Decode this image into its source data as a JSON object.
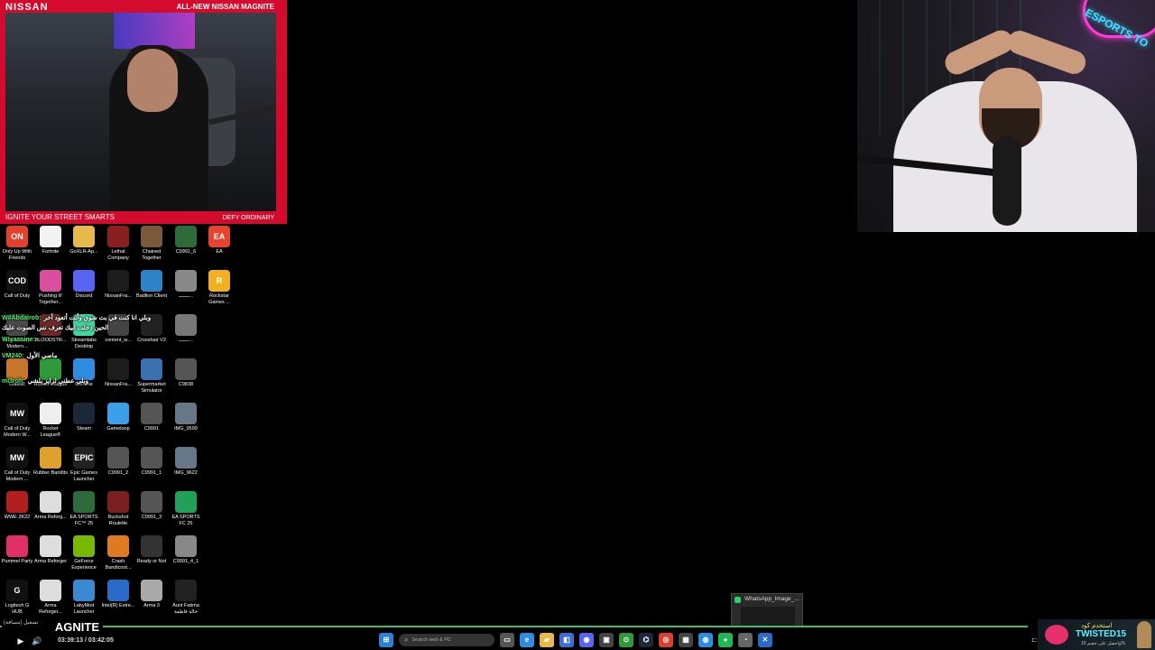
{
  "left_cam": {
    "brand": "NISSAN",
    "promo": "ALL-NEW NISSAN MAGNITE",
    "slogan": "IGNITE YOUR STREET SMARTS",
    "tagline": "DEFY ORDINARY"
  },
  "right_cam": {
    "neon_text": "ESPORTS TO"
  },
  "desktop_icons": [
    {
      "label": "Only Up With Friends",
      "glyph": "ON",
      "color": "#e2412b"
    },
    {
      "label": "Fortnite",
      "glyph": "",
      "color": "#f2f2f2"
    },
    {
      "label": "GoXLR-Ap...",
      "glyph": "",
      "color": "#e8b84a"
    },
    {
      "label": "Lethal Company",
      "glyph": "",
      "color": "#8a1f1f"
    },
    {
      "label": "Chained Together",
      "glyph": "",
      "color": "#7a5a3a"
    },
    {
      "label": "C9991_6",
      "glyph": "",
      "color": "#2f6b3a"
    },
    {
      "label": "EA",
      "glyph": "EA",
      "color": "#e8432d"
    },
    {
      "label": "Call of Duty",
      "glyph": "COD",
      "color": "#111111"
    },
    {
      "label": "Pushing it! Together...",
      "glyph": "",
      "color": "#d84fa0"
    },
    {
      "label": "Discord",
      "glyph": "",
      "color": "#5865f2"
    },
    {
      "label": "NissanFra...",
      "glyph": "",
      "color": "#1c1c1c"
    },
    {
      "label": "Badlion Client",
      "glyph": "",
      "color": "#2d82c8"
    },
    {
      "label": "ـــــــ...",
      "glyph": "",
      "color": "#888888"
    },
    {
      "label": "Rockstar Games ...",
      "glyph": "R",
      "color": "#f2b01e"
    },
    {
      "label": "Call of Duty Modern...",
      "glyph": "",
      "color": "#4a4a4a"
    },
    {
      "label": "BLOODSTR...",
      "glyph": "",
      "color": "#6b2a2a"
    },
    {
      "label": "Streamlabs Desktop",
      "glyph": "",
      "color": "#3fd6a0"
    },
    {
      "label": "content_w...",
      "glyph": "",
      "color": "#444444"
    },
    {
      "label": "Crosshair V2",
      "glyph": "",
      "color": "#222222"
    },
    {
      "label": "ـــــــ...",
      "glyph": "",
      "color": "#777777"
    },
    {
      "label": "Classic",
      "glyph": "",
      "color": "#c8742a"
    },
    {
      "label": "Rocket League",
      "glyph": "",
      "color": "#2f9a3a"
    },
    {
      "label": "Chrome",
      "glyph": "",
      "color": "#2f8de0"
    },
    {
      "label": "NissanFra...",
      "glyph": "",
      "color": "#1c1c1c"
    },
    {
      "label": "Supermarket Simulator",
      "glyph": "",
      "color": "#3a6fb0"
    },
    {
      "label": "C9838",
      "glyph": "",
      "color": "#555555"
    },
    {
      "label": "Call of Duty Modern W...",
      "glyph": "MW",
      "color": "#111111"
    },
    {
      "label": "Rocket League®",
      "glyph": "",
      "color": "#eeeeee"
    },
    {
      "label": "Steam",
      "glyph": "",
      "color": "#1b2838"
    },
    {
      "label": "Gameloop",
      "glyph": "",
      "color": "#3ca0e8"
    },
    {
      "label": "C9991",
      "glyph": "",
      "color": "#555555"
    },
    {
      "label": "IMG_9599",
      "glyph": "",
      "color": "#667788"
    },
    {
      "label": "Call of Duty Modern ...",
      "glyph": "MW",
      "color": "#111111"
    },
    {
      "label": "Rubber Bandits",
      "glyph": "",
      "color": "#e0a030"
    },
    {
      "label": "Epic Games Launcher",
      "glyph": "EPIC",
      "color": "#222222"
    },
    {
      "label": "C9991_2",
      "glyph": "",
      "color": "#555555"
    },
    {
      "label": "C9991_1",
      "glyph": "",
      "color": "#555555"
    },
    {
      "label": "IMG_9622",
      "glyph": "",
      "color": "#667788"
    },
    {
      "label": "WWE 2K22",
      "glyph": "",
      "color": "#b01e1e"
    },
    {
      "label": "Arma Reforg...",
      "glyph": "",
      "color": "#dddddd"
    },
    {
      "label": "EA SPORTS FC™ 25",
      "glyph": "",
      "color": "#2d6b3a"
    },
    {
      "label": "Buckshot Roulette",
      "glyph": "",
      "color": "#7a2020"
    },
    {
      "label": "C9991_3",
      "glyph": "",
      "color": "#555555"
    },
    {
      "label": "EA SPORTS FC 25",
      "glyph": "",
      "color": "#22a05a"
    },
    {
      "label": "Pummel Party",
      "glyph": "",
      "color": "#e0306a"
    },
    {
      "label": "Arma Reforger",
      "glyph": "",
      "color": "#dddddd"
    },
    {
      "label": "GeForce Experience",
      "glyph": "",
      "color": "#76b900"
    },
    {
      "label": "Crash Bandicoot...",
      "glyph": "",
      "color": "#e07a20"
    },
    {
      "label": "Ready or Not",
      "glyph": "",
      "color": "#333333"
    },
    {
      "label": "C9991_4_1",
      "glyph": "",
      "color": "#888888"
    },
    {
      "label": "Logitech G HUB",
      "glyph": "G",
      "color": "#111111"
    },
    {
      "label": "Arma Reforger...",
      "glyph": "",
      "color": "#dddddd"
    },
    {
      "label": "LabyMod Launcher",
      "glyph": "",
      "color": "#3a8ad0"
    },
    {
      "label": "Intel(R) Extre...",
      "glyph": "",
      "color": "#2a6ac8"
    },
    {
      "label": "Arma 3",
      "glyph": "",
      "color": "#aaaaaa"
    },
    {
      "label": "Aunt Fatima خالة فاطمة",
      "glyph": "",
      "color": "#222222"
    }
  ],
  "chat": [
    {
      "user": "W#Abdalrob:",
      "message": "وبلي انا كنت في بث شوي وأنت أتعود آخر"
    },
    {
      "user": "",
      "message": "الحين دخلت ابيك تعرف نس الصوت عليك"
    },
    {
      "user": "W!yassine:",
      "message": ""
    },
    {
      "user": "VM240:",
      "message": "ماصي الأول"
    },
    {
      "user": "mi3roh:",
      "message": "وبلي عطني لزايز بلشي"
    }
  ],
  "whatsapp_thumb": {
    "title": "WhatsApp_Image_..."
  },
  "logo_overlay": {
    "text": "AGNITE",
    "caption": "تشغيل (مسافة)"
  },
  "video_controls": {
    "time": "03:39:13 / 03:42:05",
    "progress_fraction": 0.99
  },
  "taskbar": {
    "search_placeholder": "Search web & PC",
    "apps": [
      {
        "name": "start-icon",
        "glyph": "⊞",
        "color": "#2a7fd6"
      },
      {
        "name": "task-view-icon",
        "glyph": "▭",
        "color": "#555555"
      },
      {
        "name": "edge-icon",
        "glyph": "e",
        "color": "#2f8de0"
      },
      {
        "name": "file-explorer-icon",
        "glyph": "▰",
        "color": "#e8b84a"
      },
      {
        "name": "store-icon",
        "glyph": "◧",
        "color": "#3a6fd6"
      },
      {
        "name": "discord-icon",
        "glyph": "◉",
        "color": "#5865f2"
      },
      {
        "name": "app-icon",
        "glyph": "▣",
        "color": "#444444"
      },
      {
        "name": "xbox-icon",
        "glyph": "⊙",
        "color": "#2f9a3a"
      },
      {
        "name": "steam-icon",
        "glyph": "⌬",
        "color": "#1b2838"
      },
      {
        "name": "chrome-icon",
        "glyph": "◎",
        "color": "#d84030"
      },
      {
        "name": "monitor-icon",
        "glyph": "▦",
        "color": "#444444"
      },
      {
        "name": "browser-icon",
        "glyph": "◍",
        "color": "#2f8de0"
      },
      {
        "name": "spotify-icon",
        "glyph": "●",
        "color": "#1db954"
      },
      {
        "name": "clock-icon",
        "glyph": "◔",
        "color": "#666666"
      },
      {
        "name": "capture-icon",
        "glyph": "✕",
        "color": "#2a6ac8"
      }
    ]
  },
  "sponsor": {
    "code_label": "استخدم كود",
    "code": "TWISTED15",
    "sub": "واحصل على خصم 15%"
  }
}
